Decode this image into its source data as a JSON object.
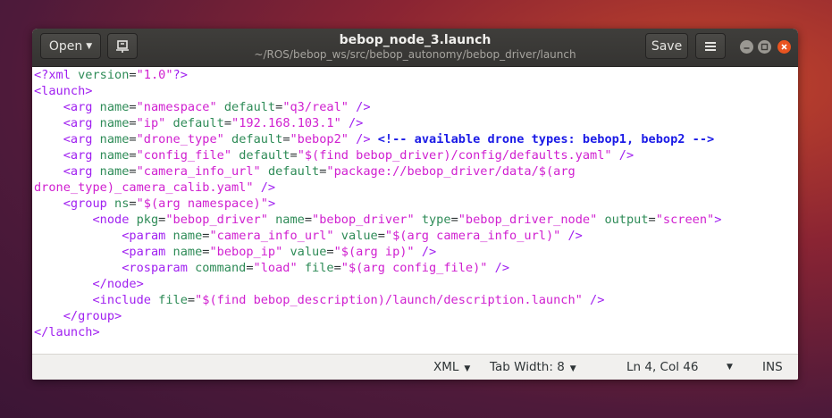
{
  "header": {
    "open_label": "Open",
    "title": "bebop_node_3.launch",
    "path": "~/ROS/bebop_ws/src/bebop_autonomy/bebop_driver/launch",
    "save_label": "Save"
  },
  "icons": {
    "open_dropdown": "chevron-down-icon",
    "pin": "pin-document-icon",
    "menu": "hamburger-menu-icon",
    "minimize": "minimize-icon",
    "maximize": "maximize-icon",
    "close": "close-icon"
  },
  "colors": {
    "tag": "#a020f0",
    "attribute": "#2e8b57",
    "value": "#d020d0",
    "comment": "#1a1ae6",
    "close_button": "#e95420"
  },
  "editor": {
    "lines": [
      [
        {
          "k": "t",
          "s": "<?xml "
        },
        {
          "k": "a",
          "s": "version"
        },
        {
          "k": "p",
          "s": "="
        },
        {
          "k": "v",
          "s": "\"1.0\""
        },
        {
          "k": "t",
          "s": "?>"
        }
      ],
      [
        {
          "k": "t",
          "s": "<launch>"
        }
      ],
      [
        {
          "k": "p",
          "s": "    "
        },
        {
          "k": "t",
          "s": "<arg "
        },
        {
          "k": "a",
          "s": "name"
        },
        {
          "k": "p",
          "s": "="
        },
        {
          "k": "v",
          "s": "\"namespace\""
        },
        {
          "k": "p",
          "s": " "
        },
        {
          "k": "a",
          "s": "default"
        },
        {
          "k": "p",
          "s": "="
        },
        {
          "k": "v",
          "s": "\"q3/real\""
        },
        {
          "k": "p",
          "s": " "
        },
        {
          "k": "t",
          "s": "/>"
        }
      ],
      [
        {
          "k": "p",
          "s": "    "
        },
        {
          "k": "t",
          "s": "<arg "
        },
        {
          "k": "a",
          "s": "name"
        },
        {
          "k": "p",
          "s": "="
        },
        {
          "k": "v",
          "s": "\"ip\""
        },
        {
          "k": "p",
          "s": " "
        },
        {
          "k": "a",
          "s": "default"
        },
        {
          "k": "p",
          "s": "="
        },
        {
          "k": "v",
          "s": "\"192.168.103.1\""
        },
        {
          "k": "p",
          "s": " "
        },
        {
          "k": "t",
          "s": "/>"
        }
      ],
      [
        {
          "k": "p",
          "s": "    "
        },
        {
          "k": "t",
          "s": "<arg "
        },
        {
          "k": "a",
          "s": "name"
        },
        {
          "k": "p",
          "s": "="
        },
        {
          "k": "v",
          "s": "\"drone_type\""
        },
        {
          "k": "p",
          "s": " "
        },
        {
          "k": "a",
          "s": "default"
        },
        {
          "k": "p",
          "s": "="
        },
        {
          "k": "v",
          "s": "\"bebop2\""
        },
        {
          "k": "p",
          "s": " "
        },
        {
          "k": "t",
          "s": "/>"
        },
        {
          "k": "p",
          "s": " "
        },
        {
          "k": "c",
          "s": "<!-- available drone types: bebop1, bebop2 -->"
        }
      ],
      [
        {
          "k": "p",
          "s": "    "
        },
        {
          "k": "t",
          "s": "<arg "
        },
        {
          "k": "a",
          "s": "name"
        },
        {
          "k": "p",
          "s": "="
        },
        {
          "k": "v",
          "s": "\"config_file\""
        },
        {
          "k": "p",
          "s": " "
        },
        {
          "k": "a",
          "s": "default"
        },
        {
          "k": "p",
          "s": "="
        },
        {
          "k": "v",
          "s": "\"$(find bebop_driver)/config/defaults.yaml\""
        },
        {
          "k": "p",
          "s": " "
        },
        {
          "k": "t",
          "s": "/>"
        }
      ],
      [
        {
          "k": "p",
          "s": "    "
        },
        {
          "k": "t",
          "s": "<arg "
        },
        {
          "k": "a",
          "s": "name"
        },
        {
          "k": "p",
          "s": "="
        },
        {
          "k": "v",
          "s": "\"camera_info_url\""
        },
        {
          "k": "p",
          "s": " "
        },
        {
          "k": "a",
          "s": "default"
        },
        {
          "k": "p",
          "s": "="
        },
        {
          "k": "v",
          "s": "\"package://bebop_driver/data/$(arg"
        }
      ],
      [
        {
          "k": "v",
          "s": "drone_type)_camera_calib.yaml\""
        },
        {
          "k": "p",
          "s": " "
        },
        {
          "k": "t",
          "s": "/>"
        }
      ],
      [
        {
          "k": "p",
          "s": "    "
        },
        {
          "k": "t",
          "s": "<group "
        },
        {
          "k": "a",
          "s": "ns"
        },
        {
          "k": "p",
          "s": "="
        },
        {
          "k": "v",
          "s": "\"$(arg namespace)\""
        },
        {
          "k": "t",
          "s": ">"
        }
      ],
      [
        {
          "k": "p",
          "s": "        "
        },
        {
          "k": "t",
          "s": "<node "
        },
        {
          "k": "a",
          "s": "pkg"
        },
        {
          "k": "p",
          "s": "="
        },
        {
          "k": "v",
          "s": "\"bebop_driver\""
        },
        {
          "k": "p",
          "s": " "
        },
        {
          "k": "a",
          "s": "name"
        },
        {
          "k": "p",
          "s": "="
        },
        {
          "k": "v",
          "s": "\"bebop_driver\""
        },
        {
          "k": "p",
          "s": " "
        },
        {
          "k": "a",
          "s": "type"
        },
        {
          "k": "p",
          "s": "="
        },
        {
          "k": "v",
          "s": "\"bebop_driver_node\""
        },
        {
          "k": "p",
          "s": " "
        },
        {
          "k": "a",
          "s": "output"
        },
        {
          "k": "p",
          "s": "="
        },
        {
          "k": "v",
          "s": "\"screen\""
        },
        {
          "k": "t",
          "s": ">"
        }
      ],
      [
        {
          "k": "p",
          "s": "            "
        },
        {
          "k": "t",
          "s": "<param "
        },
        {
          "k": "a",
          "s": "name"
        },
        {
          "k": "p",
          "s": "="
        },
        {
          "k": "v",
          "s": "\"camera_info_url\""
        },
        {
          "k": "p",
          "s": " "
        },
        {
          "k": "a",
          "s": "value"
        },
        {
          "k": "p",
          "s": "="
        },
        {
          "k": "v",
          "s": "\"$(arg camera_info_url)\""
        },
        {
          "k": "p",
          "s": " "
        },
        {
          "k": "t",
          "s": "/>"
        }
      ],
      [
        {
          "k": "p",
          "s": "            "
        },
        {
          "k": "t",
          "s": "<param "
        },
        {
          "k": "a",
          "s": "name"
        },
        {
          "k": "p",
          "s": "="
        },
        {
          "k": "v",
          "s": "\"bebop_ip\""
        },
        {
          "k": "p",
          "s": " "
        },
        {
          "k": "a",
          "s": "value"
        },
        {
          "k": "p",
          "s": "="
        },
        {
          "k": "v",
          "s": "\"$(arg ip)\""
        },
        {
          "k": "p",
          "s": " "
        },
        {
          "k": "t",
          "s": "/>"
        }
      ],
      [
        {
          "k": "p",
          "s": "            "
        },
        {
          "k": "t",
          "s": "<rosparam "
        },
        {
          "k": "a",
          "s": "command"
        },
        {
          "k": "p",
          "s": "="
        },
        {
          "k": "v",
          "s": "\"load\""
        },
        {
          "k": "p",
          "s": " "
        },
        {
          "k": "a",
          "s": "file"
        },
        {
          "k": "p",
          "s": "="
        },
        {
          "k": "v",
          "s": "\"$(arg config_file)\""
        },
        {
          "k": "p",
          "s": " "
        },
        {
          "k": "t",
          "s": "/>"
        }
      ],
      [
        {
          "k": "p",
          "s": "        "
        },
        {
          "k": "t",
          "s": "</node>"
        }
      ],
      [
        {
          "k": "p",
          "s": "        "
        },
        {
          "k": "t",
          "s": "<include "
        },
        {
          "k": "a",
          "s": "file"
        },
        {
          "k": "p",
          "s": "="
        },
        {
          "k": "v",
          "s": "\"$(find bebop_description)/launch/description.launch\""
        },
        {
          "k": "p",
          "s": " "
        },
        {
          "k": "t",
          "s": "/>"
        }
      ],
      [
        {
          "k": "p",
          "s": "    "
        },
        {
          "k": "t",
          "s": "</group>"
        }
      ],
      [
        {
          "k": "t",
          "s": "</launch>"
        }
      ]
    ]
  },
  "status": {
    "language": "XML",
    "tab_width": "Tab Width: 8",
    "position": "Ln 4, Col 46",
    "mode": "INS"
  }
}
